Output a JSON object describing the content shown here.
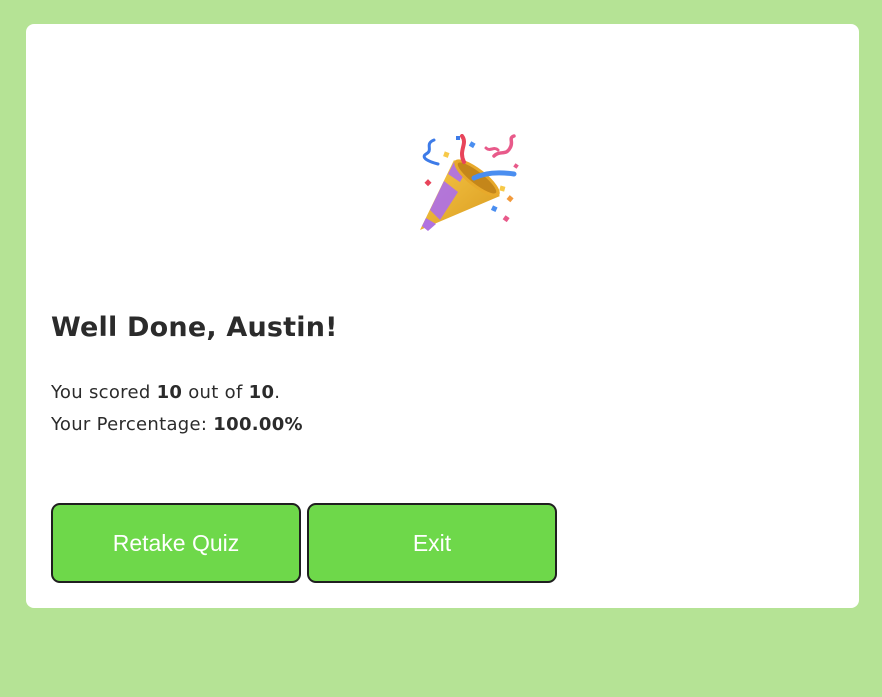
{
  "result": {
    "emoji_icon": "party-popper-icon",
    "title": "Well Done, Austin!",
    "score_prefix": "You scored ",
    "score_value": "10",
    "score_middle": " out of ",
    "score_total": "10",
    "score_suffix": ".",
    "percentage_label": "Your Percentage: ",
    "percentage_value": "100.00%"
  },
  "actions": {
    "retake_label": "Retake Quiz",
    "exit_label": "Exit"
  },
  "colors": {
    "background": "#b5e395",
    "card": "#ffffff",
    "button": "#6ed84a",
    "button_border": "#1f1f1f",
    "text": "#2b2b2b"
  }
}
